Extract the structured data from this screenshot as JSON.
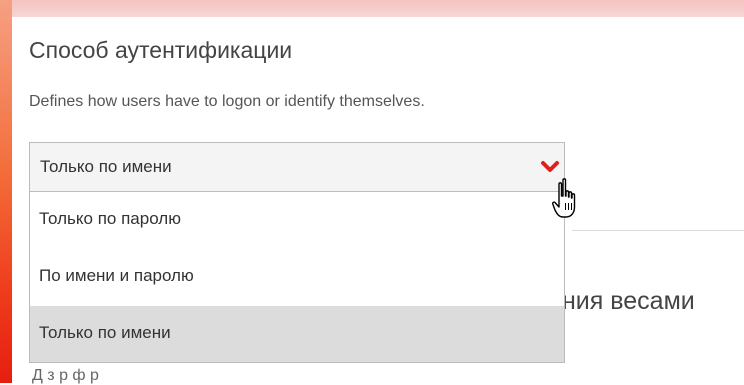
{
  "section": {
    "title": "Способ аутентификации",
    "description": "Defines how users have to logon or identify themselves."
  },
  "select": {
    "selected_value": "Только по имени",
    "toggle_icon": "chevron-down-icon",
    "accent_color": "#e0201a",
    "options": [
      {
        "label": "Только по паролю",
        "selected": false
      },
      {
        "label": "По имени и паролю",
        "selected": false
      },
      {
        "label": "Только по имени",
        "selected": true
      }
    ]
  },
  "background_section": {
    "heading_fragment": "ния весами"
  },
  "cursor_icon": "hand-pointer-icon"
}
